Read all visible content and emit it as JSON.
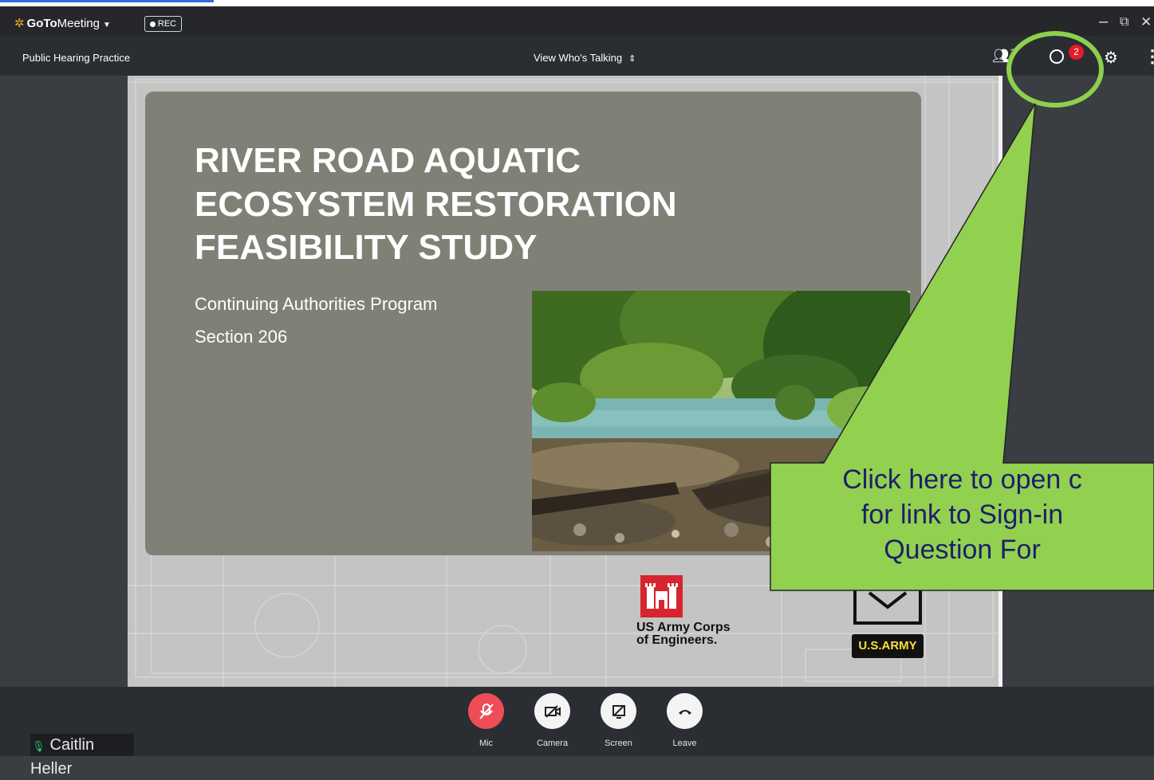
{
  "app": {
    "brand_bold": "GoTo",
    "brand_rest": "Meeting",
    "brand_caret": "▼",
    "rec_label": "REC",
    "minimize": "–",
    "restore": "⧉",
    "close": "✕"
  },
  "subbar": {
    "meeting_title": "Public Hearing Practice",
    "view_talking": "View Who's Talking",
    "view_talking_icon": "⇕",
    "participants_icon": "people-icon",
    "participants_count": "2",
    "chat_badge": "2"
  },
  "slide": {
    "title_lines": [
      "RIVER ROAD AQUATIC",
      "ECOSYSTEM RESTORATION",
      "FEASIBILITY STUDY"
    ],
    "sub_lines": [
      "Continuing Authorities Program",
      "Section 206"
    ],
    "usace_line1": "US Army Corps",
    "usace_line2": "of Engineers.",
    "army_label": "U.S.ARMY",
    "colors": {
      "panel": "#818076",
      "usace_red": "#d6252e",
      "army_gold": "#ffdf3a"
    }
  },
  "controls": [
    {
      "label": "Mic"
    },
    {
      "label": "Camera"
    },
    {
      "label": "Screen"
    },
    {
      "label": "Leave"
    }
  ],
  "speaker": {
    "name": "Caitlin Heller"
  },
  "callout": {
    "lines": [
      "Click here to open c",
      "for link to Sign-in",
      "Question For"
    ],
    "fill": "#92d050",
    "highlight": "#8cd04e"
  }
}
